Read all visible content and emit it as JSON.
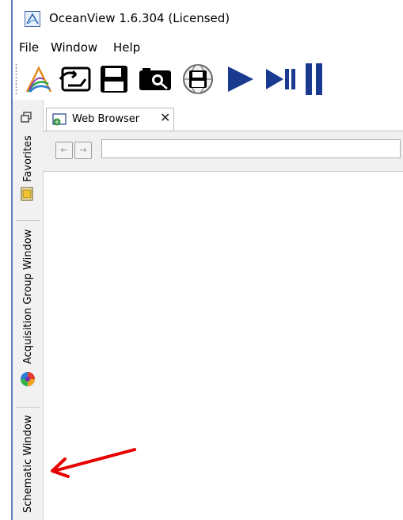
{
  "window": {
    "title": "OceanView 1.6.304 (Licensed)"
  },
  "menu": {
    "items": [
      "File",
      "Window",
      "Help"
    ]
  },
  "toolbar": {
    "buttons": [
      "oceanview-logo-icon",
      "open-schematic-icon",
      "save-icon",
      "camera-icon",
      "save-globe-icon",
      "play-icon",
      "play-pause-icon",
      "pause-icon"
    ]
  },
  "sidebar": {
    "tabs": [
      {
        "label": "Favorites",
        "icon": "favorites-icon"
      },
      {
        "label": "Acquisition Group Window",
        "icon": "acquisition-group-icon"
      },
      {
        "label": "Schematic Window"
      }
    ]
  },
  "tabs": [
    {
      "label": "Web Browser",
      "close": "✕"
    }
  ],
  "browser": {
    "back": "←",
    "forward": "→",
    "url": ""
  },
  "colors": {
    "accent": "#1a3a8f",
    "annotation_arrow": "#e60000"
  }
}
